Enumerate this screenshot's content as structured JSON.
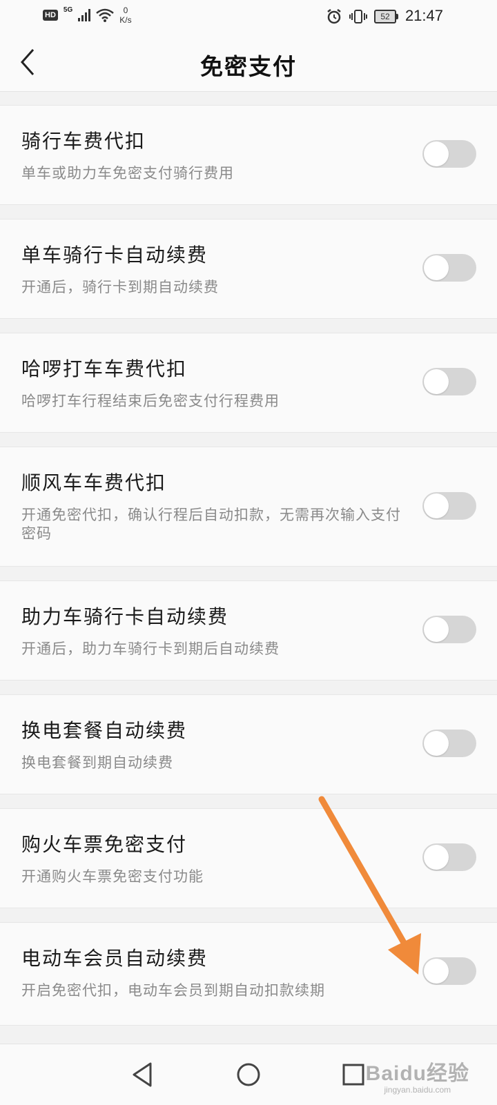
{
  "status_bar": {
    "hd": "HD",
    "network": "5G",
    "speed_value": "0",
    "speed_unit": "K/s",
    "battery": "52",
    "time": "21:47"
  },
  "header": {
    "title": "免密支付"
  },
  "settings": [
    {
      "title": "骑行车费代扣",
      "desc": "单车或助力车免密支付骑行费用",
      "enabled": false
    },
    {
      "title": "单车骑行卡自动续费",
      "desc": "开通后，骑行卡到期自动续费",
      "enabled": false
    },
    {
      "title": "哈啰打车车费代扣",
      "desc": "哈啰打车行程结束后免密支付行程费用",
      "enabled": false
    },
    {
      "title": "顺风车车费代扣",
      "desc": "开通免密代扣，确认行程后自动扣款，无需再次输入支付密码",
      "enabled": false
    },
    {
      "title": "助力车骑行卡自动续费",
      "desc": "开通后，助力车骑行卡到期后自动续费",
      "enabled": false
    },
    {
      "title": "换电套餐自动续费",
      "desc": "换电套餐到期自动续费",
      "enabled": false
    },
    {
      "title": "购火车票免密支付",
      "desc": "开通购火车票免密支付功能",
      "enabled": false
    },
    {
      "title": "电动车会员自动续费",
      "desc": "开启免密代扣，电动车会员到期自动扣款续期",
      "enabled": false
    }
  ],
  "watermark": {
    "main": "Baidu经验",
    "sub": "jingyan.baidu.com"
  },
  "colors": {
    "toggle_off": "#d6d6d6",
    "annotation_arrow": "#f08a3a"
  }
}
